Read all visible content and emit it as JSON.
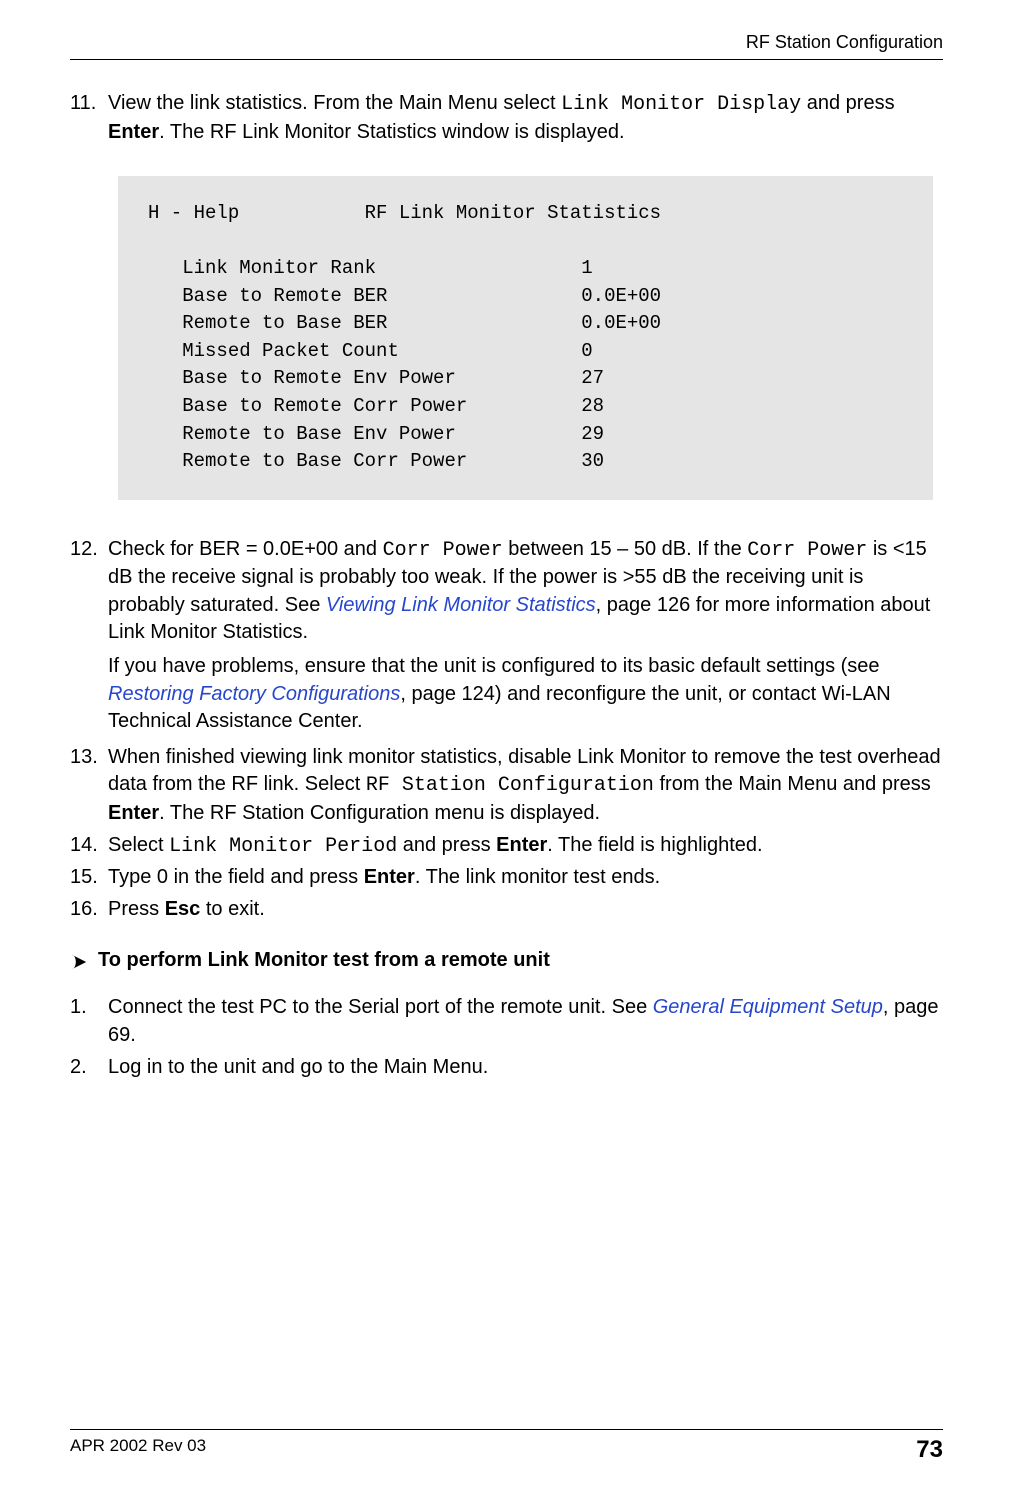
{
  "header": {
    "title": "RF Station Configuration"
  },
  "codeblock": {
    "line1": "H - Help           RF Link Monitor Statistics",
    "line2": "",
    "line3": "   Link Monitor Rank                  1",
    "line4": "   Base to Remote BER                 0.0E+00",
    "line5": "   Remote to Base BER                 0.0E+00",
    "line6": "   Missed Packet Count                0",
    "line7": "   Base to Remote Env Power           27",
    "line8": "   Base to Remote Corr Power          28",
    "line9": "   Remote to Base Env Power           29",
    "line10": "   Remote to Base Corr Power          30"
  },
  "steps_a": [
    {
      "num": "11.",
      "parts": [
        {
          "t": "View the link statistics. From the Main Menu select "
        },
        {
          "t": "Link Monitor Display",
          "mono": true
        },
        {
          "t": " and press "
        },
        {
          "t": "Enter",
          "bold": true
        },
        {
          "t": ". The RF Link Monitor Statistics window is displayed."
        }
      ]
    }
  ],
  "steps_b": [
    {
      "num": "12.",
      "paragraphs": [
        [
          {
            "t": "Check for BER = 0.0E+00 and "
          },
          {
            "t": "Corr Power",
            "mono": true
          },
          {
            "t": " between 15 – 50 dB. If the "
          },
          {
            "t": "Corr Power",
            "mono": true
          },
          {
            "t": " is <15 dB the receive signal is probably too weak. If the power is >55 dB the receiving unit is probably saturated. See "
          },
          {
            "t": "Viewing Link Monitor Statistics",
            "link": true
          },
          {
            "t": ", page 126 for more information about Link Monitor Statistics."
          }
        ],
        [
          {
            "t": "If you have problems, ensure that the unit is configured to its basic default settings (see "
          },
          {
            "t": "Restoring Factory Configurations",
            "link": true
          },
          {
            "t": ", page 124) and reconfigure the unit, or contact Wi-LAN Technical Assistance Center."
          }
        ]
      ]
    },
    {
      "num": "13.",
      "paragraphs": [
        [
          {
            "t": "When finished viewing link monitor statistics, disable Link Monitor to remove the test overhead data from the RF link. Select "
          },
          {
            "t": "RF Station Configuration",
            "mono": true
          },
          {
            "t": " from the Main Menu and press "
          },
          {
            "t": "Enter",
            "bold": true
          },
          {
            "t": ". The RF Station Configuration menu is displayed."
          }
        ]
      ]
    },
    {
      "num": "14.",
      "paragraphs": [
        [
          {
            "t": "Select "
          },
          {
            "t": "Link Monitor Period",
            "mono": true
          },
          {
            "t": " and press "
          },
          {
            "t": "Enter",
            "bold": true
          },
          {
            "t": ". The field is highlighted."
          }
        ]
      ]
    },
    {
      "num": "15.",
      "paragraphs": [
        [
          {
            "t": "Type 0 in the field and press "
          },
          {
            "t": "Enter",
            "bold": true
          },
          {
            "t": ". The link monitor test ends."
          }
        ]
      ]
    },
    {
      "num": "16.",
      "paragraphs": [
        [
          {
            "t": "Press "
          },
          {
            "t": "Esc",
            "bold": true
          },
          {
            "t": " to exit."
          }
        ]
      ]
    }
  ],
  "subhead": {
    "title": "To perform Link Monitor test from a remote unit"
  },
  "steps_c": [
    {
      "num": "1.",
      "paragraphs": [
        [
          {
            "t": "Connect the test PC to the Serial port of the remote unit. See "
          },
          {
            "t": "General Equipment Setup",
            "link": true
          },
          {
            "t": ", page 69."
          }
        ]
      ]
    },
    {
      "num": "2.",
      "paragraphs": [
        [
          {
            "t": "Log in to the unit and go to the Main Menu."
          }
        ]
      ]
    }
  ],
  "footer": {
    "left": "APR 2002 Rev 03",
    "page": "73"
  }
}
